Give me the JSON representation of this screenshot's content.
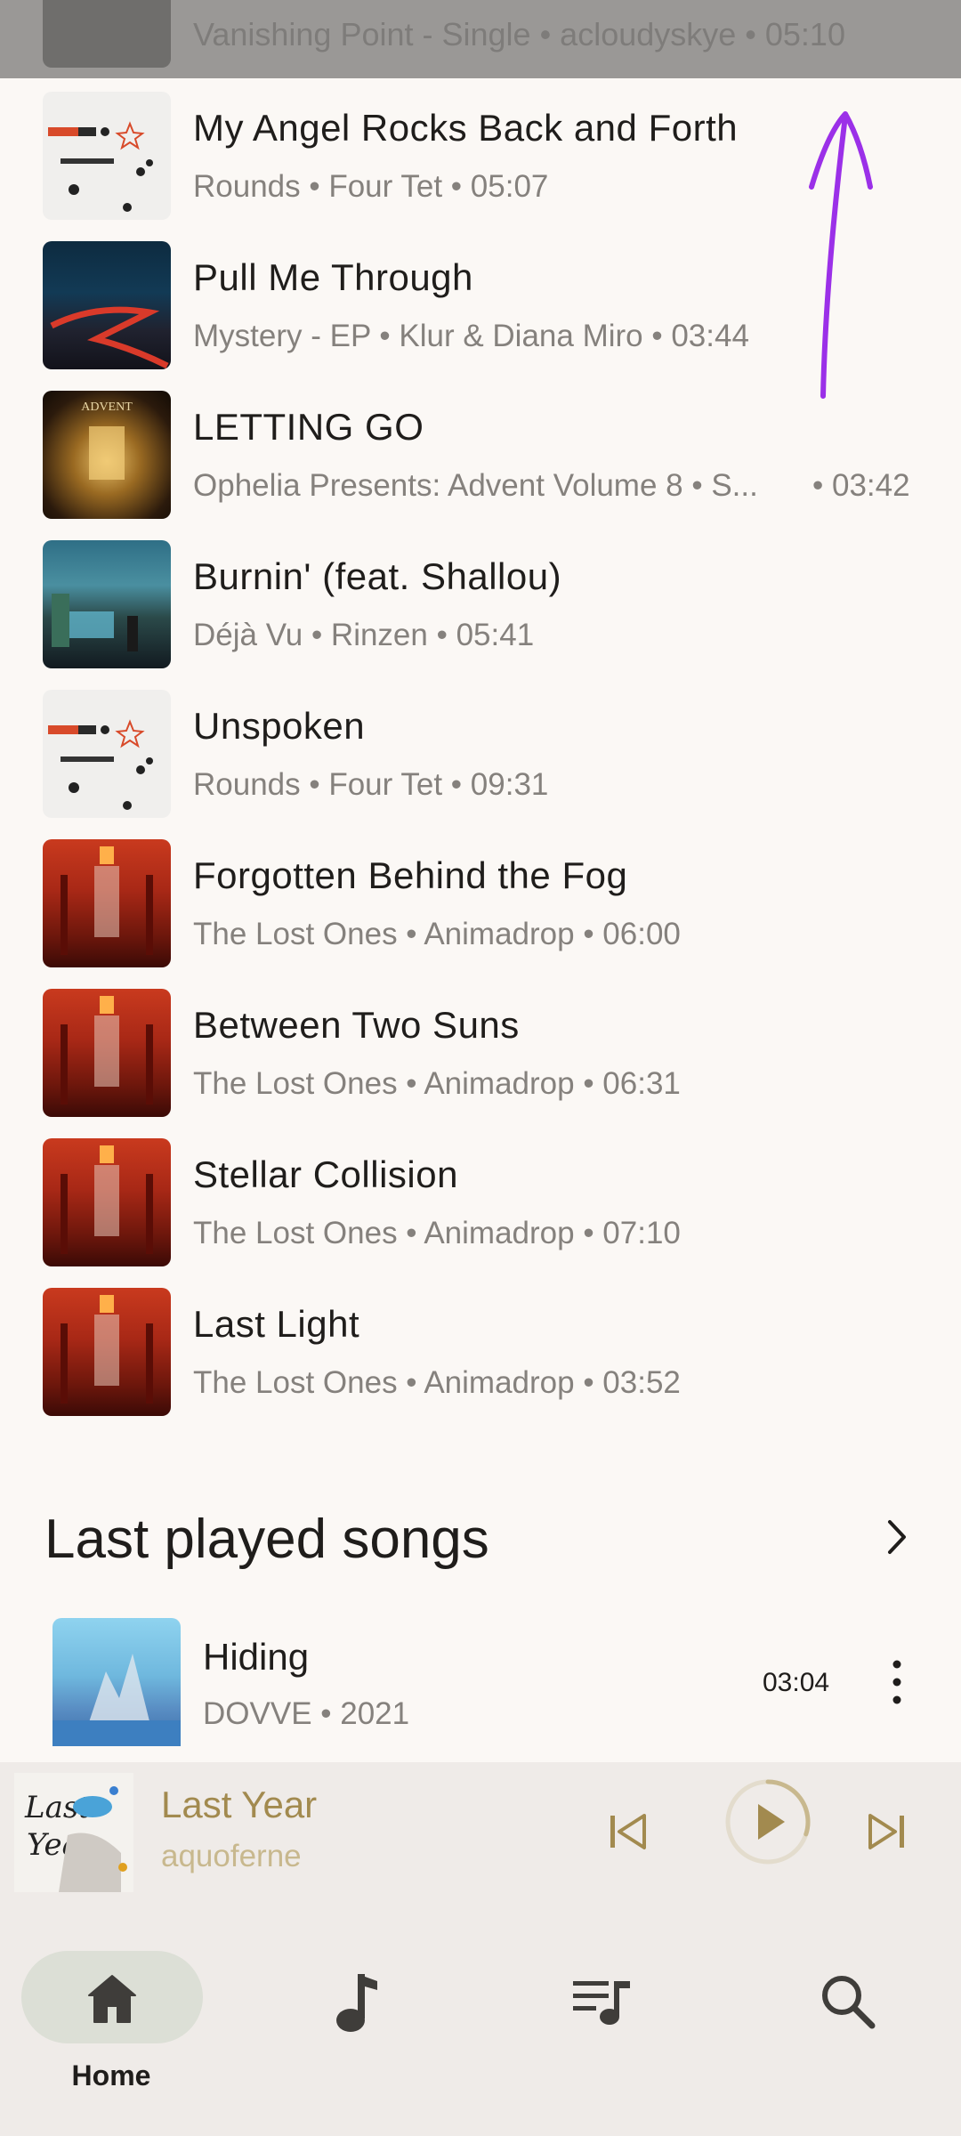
{
  "partial_row": {
    "subtitle": "Vanishing Point - Single • acloudyskye • 05:10"
  },
  "songs": [
    {
      "title": "My Angel Rocks Back and Forth",
      "meta": "Rounds • Four Tet • 05:07",
      "art": "four-tet-rounds-art"
    },
    {
      "title": "Pull Me Through",
      "meta": "Mystery - EP • Klur & Diana Miro • 03:44",
      "art": "mystery-ep-art"
    },
    {
      "title": "LETTING GO",
      "meta": "Ophelia Presents: Advent Volume 8 • S...",
      "meta_duration": "• 03:42",
      "art": "advent-art"
    },
    {
      "title": "Burnin' (feat. Shallou)",
      "meta": "Déjà Vu • Rinzen • 05:41",
      "art": "deja-vu-art"
    },
    {
      "title": "Unspoken",
      "meta": "Rounds • Four Tet • 09:31",
      "art": "four-tet-rounds-art"
    },
    {
      "title": "Forgotten Behind the Fog",
      "meta": "The Lost Ones • Animadrop • 06:00",
      "art": "lost-ones-art"
    },
    {
      "title": "Between Two Suns",
      "meta": "The Lost Ones • Animadrop • 06:31",
      "art": "lost-ones-art"
    },
    {
      "title": "Stellar Collision",
      "meta": "The Lost Ones • Animadrop • 07:10",
      "art": "lost-ones-art"
    },
    {
      "title": "Last Light",
      "meta": "The Lost Ones • Animadrop • 03:52",
      "art": "lost-ones-art"
    }
  ],
  "last_played": {
    "heading": "Last played songs",
    "item": {
      "title": "Hiding",
      "meta": "DOVVE • 2021",
      "duration": "03:04"
    }
  },
  "mini_player": {
    "title": "Last Year",
    "artist": "aquoferne",
    "progress": 0.3,
    "accent": "#a28a4f"
  },
  "nav": {
    "items": [
      {
        "label": "Home",
        "icon": "home-icon",
        "selected": true
      },
      {
        "label": "",
        "icon": "music-note-icon"
      },
      {
        "label": "",
        "icon": "queue-music-icon"
      },
      {
        "label": "",
        "icon": "search-icon"
      }
    ]
  },
  "colors": {
    "background": "#fbf8f5",
    "nav_background": "#efebe8",
    "gesture": "#9b30e8"
  }
}
